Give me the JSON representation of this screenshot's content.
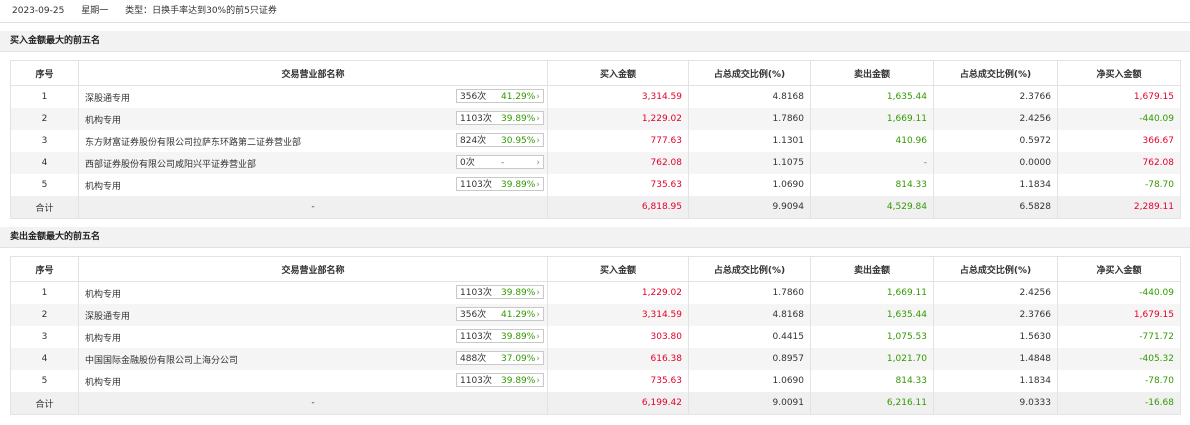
{
  "header": {
    "date": "2023-09-25",
    "weekday": "星期一",
    "type_label": "类型：",
    "type_value": "日换手率达到30%的前5只证券"
  },
  "buy_section": {
    "title": "买入金额最大的前五名",
    "columns": [
      "序号",
      "交易营业部名称",
      "买入金额",
      "占总成交比例(%)",
      "卖出金额",
      "占总成交比例(%)",
      "净买入金额"
    ],
    "rows": [
      {
        "idx": "1",
        "name": "深股通专用",
        "count": "356次",
        "pct": "41.29%",
        "arrow": "›",
        "buy": "3,314.59",
        "buy_ratio": "4.8168",
        "sell": "1,635.44",
        "sell_ratio": "2.3766",
        "net": "1,679.15",
        "net_color": "red"
      },
      {
        "idx": "2",
        "name": "机构专用",
        "count": "1103次",
        "pct": "39.89%",
        "arrow": "›",
        "buy": "1,229.02",
        "buy_ratio": "1.7860",
        "sell": "1,669.11",
        "sell_ratio": "2.4256",
        "net": "-440.09",
        "net_color": "green"
      },
      {
        "idx": "3",
        "name": "东方财富证券股份有限公司拉萨东环路第二证券营业部",
        "count": "824次",
        "pct": "30.95%",
        "arrow": "›",
        "buy": "777.63",
        "buy_ratio": "1.1301",
        "sell": "410.96",
        "sell_ratio": "0.5972",
        "net": "366.67",
        "net_color": "red"
      },
      {
        "idx": "4",
        "name": "西部证券股份有限公司咸阳兴平证券营业部",
        "count": "0次",
        "pct": "-",
        "arrow": "›",
        "buy": "762.08",
        "buy_ratio": "1.1075",
        "sell": "-",
        "sell_ratio": "0.0000",
        "net": "762.08",
        "net_color": "red"
      },
      {
        "idx": "5",
        "name": "机构专用",
        "count": "1103次",
        "pct": "39.89%",
        "arrow": "›",
        "buy": "735.63",
        "buy_ratio": "1.0690",
        "sell": "814.33",
        "sell_ratio": "1.1834",
        "net": "-78.70",
        "net_color": "green"
      }
    ],
    "total": {
      "label": "合计",
      "name": "-",
      "buy": "6,818.95",
      "buy_ratio": "9.9094",
      "sell": "4,529.84",
      "sell_ratio": "6.5828",
      "net": "2,289.11",
      "net_color": "red"
    }
  },
  "sell_section": {
    "title": "卖出金额最大的前五名",
    "columns": [
      "序号",
      "交易营业部名称",
      "买入金额",
      "占总成交比例(%)",
      "卖出金额",
      "占总成交比例(%)",
      "净买入金额"
    ],
    "rows": [
      {
        "idx": "1",
        "name": "机构专用",
        "count": "1103次",
        "pct": "39.89%",
        "arrow": "›",
        "buy": "1,229.02",
        "buy_ratio": "1.7860",
        "sell": "1,669.11",
        "sell_ratio": "2.4256",
        "net": "-440.09",
        "net_color": "green"
      },
      {
        "idx": "2",
        "name": "深股通专用",
        "count": "356次",
        "pct": "41.29%",
        "arrow": "›",
        "buy": "3,314.59",
        "buy_ratio": "4.8168",
        "sell": "1,635.44",
        "sell_ratio": "2.3766",
        "net": "1,679.15",
        "net_color": "red"
      },
      {
        "idx": "3",
        "name": "机构专用",
        "count": "1103次",
        "pct": "39.89%",
        "arrow": "›",
        "buy": "303.80",
        "buy_ratio": "0.4415",
        "sell": "1,075.53",
        "sell_ratio": "1.5630",
        "net": "-771.72",
        "net_color": "green"
      },
      {
        "idx": "4",
        "name": "中国国际金融股份有限公司上海分公司",
        "count": "488次",
        "pct": "37.09%",
        "arrow": "›",
        "buy": "616.38",
        "buy_ratio": "0.8957",
        "sell": "1,021.70",
        "sell_ratio": "1.4848",
        "net": "-405.32",
        "net_color": "green"
      },
      {
        "idx": "5",
        "name": "机构专用",
        "count": "1103次",
        "pct": "39.89%",
        "arrow": "›",
        "buy": "735.63",
        "buy_ratio": "1.0690",
        "sell": "814.33",
        "sell_ratio": "1.1834",
        "net": "-78.70",
        "net_color": "green"
      }
    ],
    "total": {
      "label": "合计",
      "name": "-",
      "buy": "6,199.42",
      "buy_ratio": "9.0091",
      "sell": "6,216.11",
      "sell_ratio": "9.0333",
      "net": "-16.68",
      "net_color": "green"
    }
  },
  "colors": {
    "up": "#e4002b",
    "down": "#339900"
  }
}
